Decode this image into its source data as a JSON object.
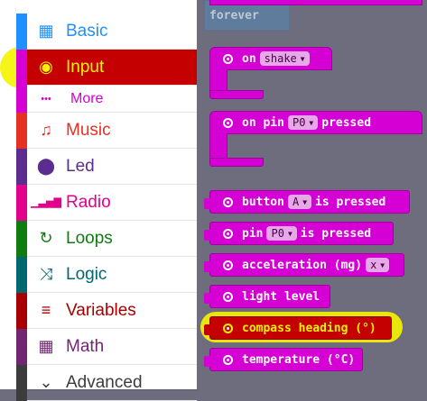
{
  "categories": [
    {
      "label": "Basic",
      "color": "#1e90ff",
      "icon": "grid-icon",
      "glyph": "▦"
    },
    {
      "label": "Input",
      "color": "#d400d4",
      "icon": "radio-target-icon",
      "glyph": "◉",
      "selected": true
    },
    {
      "label": "More",
      "color": "#d400d4",
      "icon": "more-dots-icon",
      "glyph": "•••"
    },
    {
      "label": "Music",
      "color": "#e63022",
      "icon": "headphones-icon",
      "glyph": "♫"
    },
    {
      "label": "Led",
      "color": "#5c2d91",
      "icon": "toggle-icon",
      "glyph": "⬤"
    },
    {
      "label": "Radio",
      "color": "#e3008c",
      "icon": "signal-bars-icon",
      "glyph": "▁▃▅▇"
    },
    {
      "label": "Loops",
      "color": "#107c10",
      "icon": "refresh-icon",
      "glyph": "↻"
    },
    {
      "label": "Logic",
      "color": "#006970",
      "icon": "shuffle-icon",
      "glyph": "⤨"
    },
    {
      "label": "Variables",
      "color": "#a80000",
      "icon": "lines-icon",
      "glyph": "≡"
    },
    {
      "label": "Math",
      "color": "#712672",
      "icon": "calculator-icon",
      "glyph": "▦"
    },
    {
      "label": "Advanced",
      "color": "#3c3c3c",
      "icon": "chevron-icon",
      "glyph": "⌄"
    }
  ],
  "workspace": {
    "forever_label": "forever",
    "on_shake": {
      "prefix": "on",
      "value": "shake"
    },
    "on_pin_pressed": {
      "prefix": "on pin",
      "value": "P0",
      "suffix": "pressed"
    },
    "button_pressed": {
      "prefix": "button",
      "value": "A",
      "suffix": "is pressed"
    },
    "pin_pressed": {
      "prefix": "pin",
      "value": "P0",
      "suffix": "is pressed"
    },
    "acceleration": {
      "prefix": "acceleration (mg)",
      "value": "x"
    },
    "light_level": "light level",
    "compass_heading": "compass heading (°)",
    "temperature": "temperature (°C)"
  },
  "colors": {
    "input": "#d400d4",
    "highlight": "#f6f300",
    "workspace": "#6d6d7e"
  }
}
